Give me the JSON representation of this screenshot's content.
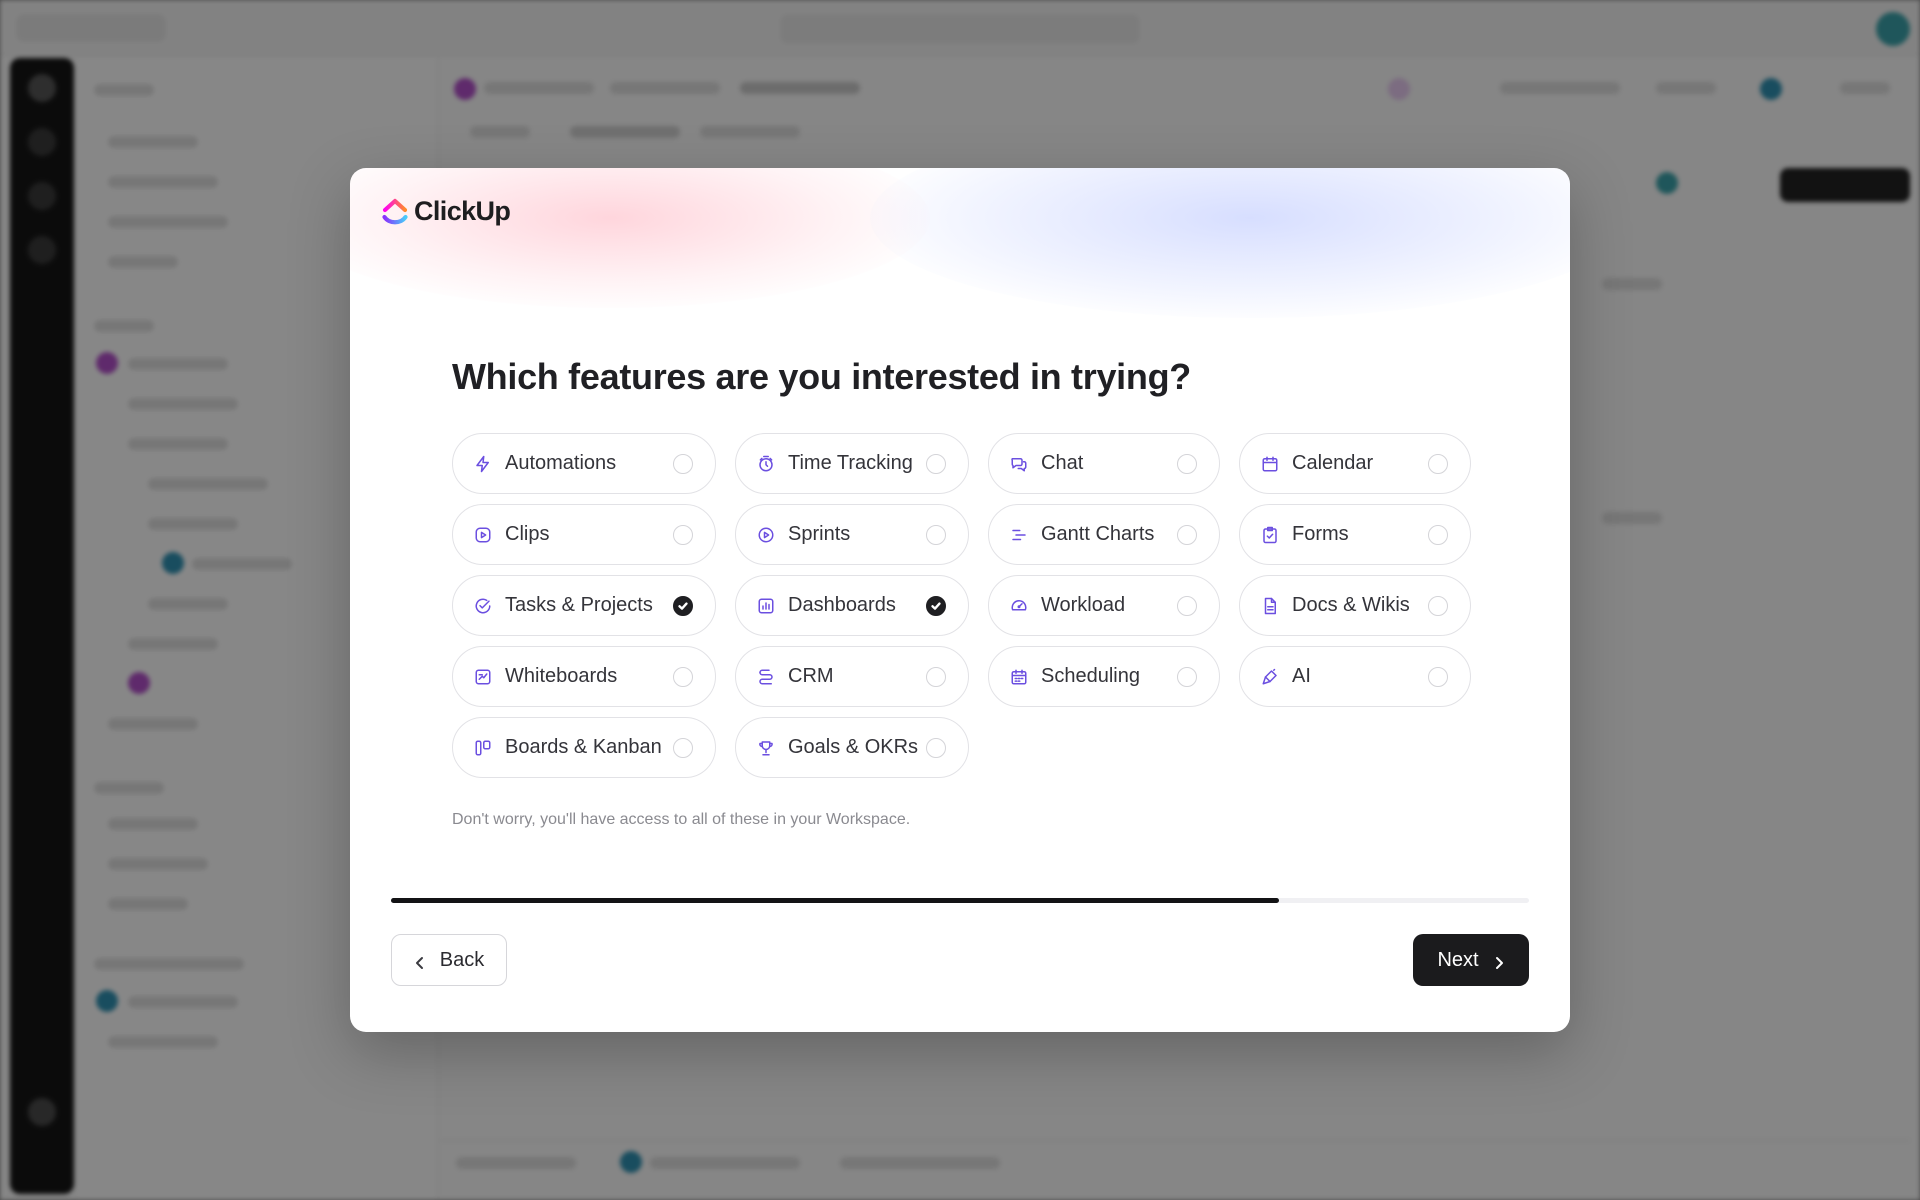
{
  "modal": {
    "brand": "ClickUp",
    "title": "Which features are you interested in trying?",
    "note": "Don't worry, you'll have access to all of these in your Workspace.",
    "progress": 0.78,
    "back_label": "Back",
    "next_label": "Next"
  },
  "colors": {
    "accent": "#6b4fe0",
    "primary_button": "#1b1b1d",
    "logo_gradient": [
      "#fa12e3",
      "#ff5d34",
      "#7b5cff"
    ]
  },
  "features": [
    {
      "label": "Automations",
      "icon": "bolt-icon",
      "selected": false
    },
    {
      "label": "Time Tracking",
      "icon": "stopwatch-icon",
      "selected": false
    },
    {
      "label": "Chat",
      "icon": "chat-bubbles-icon",
      "selected": false
    },
    {
      "label": "Calendar",
      "icon": "calendar-icon",
      "selected": false
    },
    {
      "label": "Clips",
      "icon": "play-square-icon",
      "selected": false
    },
    {
      "label": "Sprints",
      "icon": "play-circle-icon",
      "selected": false
    },
    {
      "label": "Gantt Charts",
      "icon": "gantt-icon",
      "selected": false
    },
    {
      "label": "Forms",
      "icon": "clipboard-check-icon",
      "selected": false
    },
    {
      "label": "Tasks & Projects",
      "icon": "check-circle-icon",
      "selected": true
    },
    {
      "label": "Dashboards",
      "icon": "bar-chart-icon",
      "selected": true
    },
    {
      "label": "Workload",
      "icon": "gauge-icon",
      "selected": false
    },
    {
      "label": "Docs & Wikis",
      "icon": "document-icon",
      "selected": false
    },
    {
      "label": "Whiteboards",
      "icon": "whiteboard-icon",
      "selected": false
    },
    {
      "label": "CRM",
      "icon": "crm-icon",
      "selected": false
    },
    {
      "label": "Scheduling",
      "icon": "calendar-grid-icon",
      "selected": false
    },
    {
      "label": "AI",
      "icon": "ai-brush-icon",
      "selected": false
    },
    {
      "label": "Boards & Kanban",
      "icon": "kanban-icon",
      "selected": false
    },
    {
      "label": "Goals & OKRs",
      "icon": "trophy-icon",
      "selected": false
    }
  ]
}
